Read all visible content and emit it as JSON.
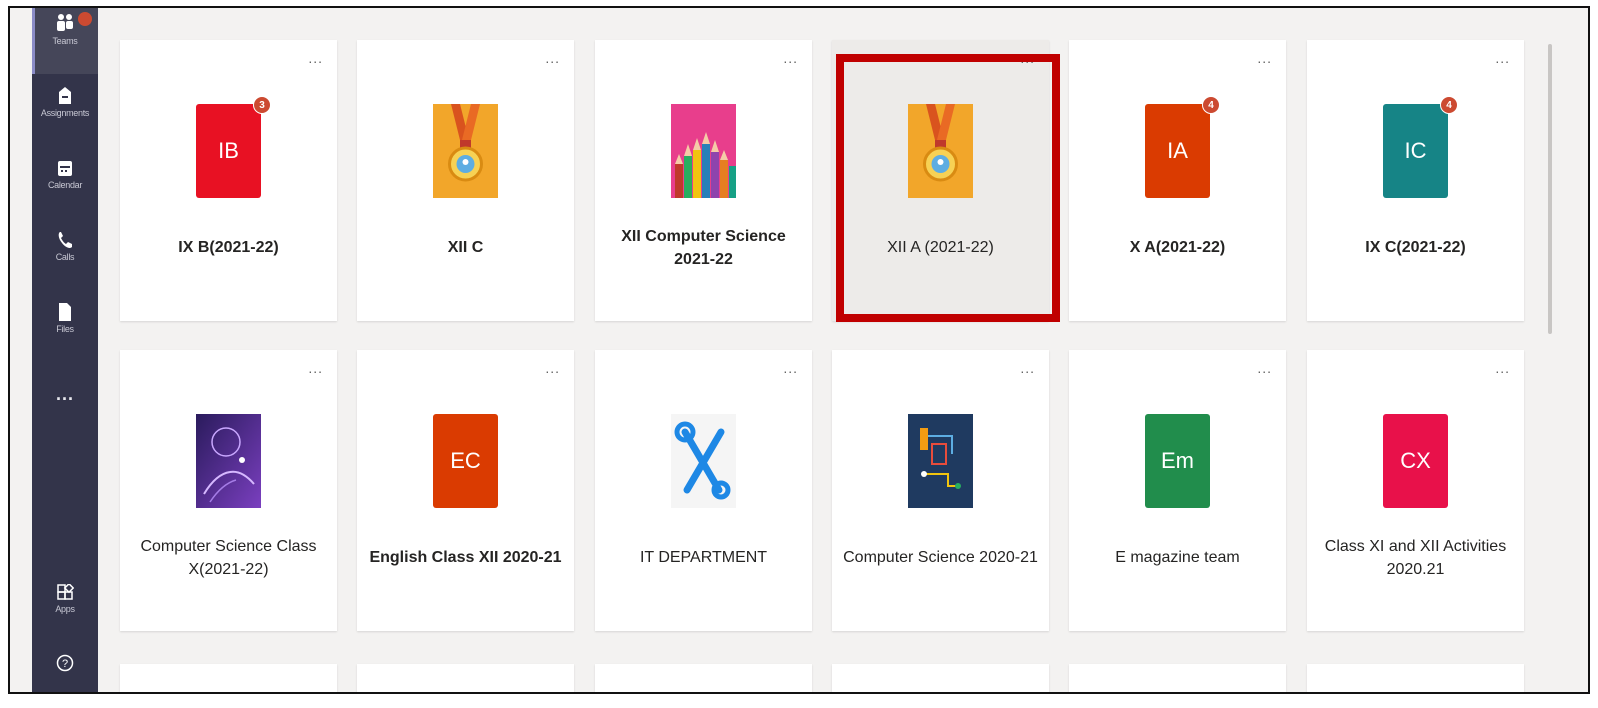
{
  "rail": {
    "items": [
      {
        "label": "Teams",
        "icon": "teams-icon"
      },
      {
        "label": "Assignments",
        "icon": "assignments-icon"
      },
      {
        "label": "Calendar",
        "icon": "calendar-icon"
      },
      {
        "label": "Calls",
        "icon": "calls-icon"
      },
      {
        "label": "Files",
        "icon": "files-icon"
      },
      {
        "label": "...",
        "icon": "more-icon"
      },
      {
        "label": "Apps",
        "icon": "apps-icon"
      },
      {
        "label": "",
        "icon": "help-icon"
      }
    ]
  },
  "teams": [
    {
      "name": "IX B(2021-22)",
      "tile_text": "IB",
      "tile_color": "#e81123",
      "badge": "3",
      "bold": true
    },
    {
      "name": "XII C",
      "tile_text": "",
      "tile_color": "#f2a62a",
      "badge": "",
      "bold": true,
      "image": "medal"
    },
    {
      "name": "XII Computer Science 2021-22",
      "tile_text": "",
      "tile_color": "#e83e8c",
      "badge": "",
      "bold": true,
      "image": "pencils"
    },
    {
      "name": "XII A (2021-22)",
      "tile_text": "",
      "tile_color": "#f2a62a",
      "badge": "",
      "bold": false,
      "image": "medal",
      "selected": true
    },
    {
      "name": "X A(2021-22)",
      "tile_text": "IA",
      "tile_color": "#da3b01",
      "badge": "4",
      "bold": true
    },
    {
      "name": "IX C(2021-22)",
      "tile_text": "IC",
      "tile_color": "#168486",
      "badge": "4",
      "bold": true
    },
    {
      "name": "Computer Science Class X(2021-22)",
      "tile_text": "",
      "tile_color": "#4b2a86",
      "badge": "",
      "bold": false,
      "image": "ai-hand"
    },
    {
      "name": "English Class XII 2020-21",
      "tile_text": "EC",
      "tile_color": "#da3b01",
      "badge": "",
      "bold": true
    },
    {
      "name": "IT DEPARTMENT",
      "tile_text": "",
      "tile_color": "#ffffff",
      "badge": "",
      "bold": false,
      "image": "tools"
    },
    {
      "name": "Computer Science 2020-21",
      "tile_text": "",
      "tile_color": "#1f3a60",
      "badge": "",
      "bold": false,
      "image": "circuit"
    },
    {
      "name": "E magazine team",
      "tile_text": "Em",
      "tile_color": "#218d4c",
      "badge": "",
      "bold": false
    },
    {
      "name": "Class XI and XII Activities 2020.21",
      "tile_text": "CX",
      "tile_color": "#e8114a",
      "badge": "",
      "bold": false
    }
  ],
  "more_label": "..."
}
